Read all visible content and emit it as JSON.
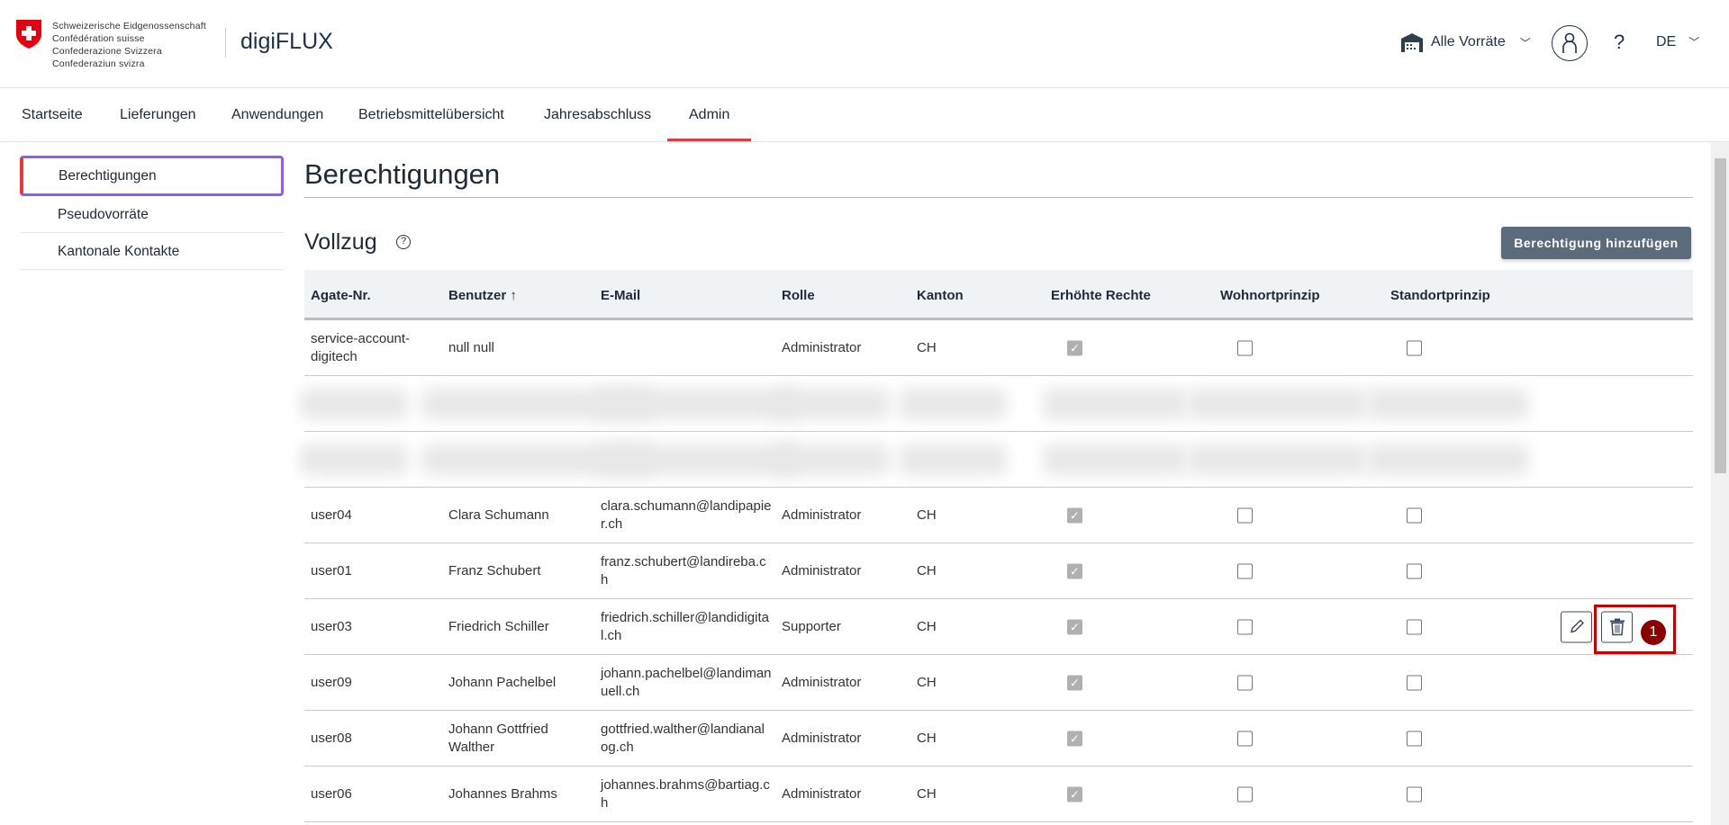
{
  "header": {
    "confederation": [
      "Schweizerische Eidgenossenschaft",
      "Confédération suisse",
      "Confederazione Svizzera",
      "Confederaziun svizra"
    ],
    "app_name": "digiFLUX",
    "stock_selector": "Alle Vorräte",
    "help": "?",
    "language": "DE"
  },
  "nav": {
    "tabs": [
      {
        "label": "Startseite"
      },
      {
        "label": "Lieferungen"
      },
      {
        "label": "Anwendungen"
      },
      {
        "label": "Betriebsmittelübersicht"
      },
      {
        "label": "Jahresabschluss"
      },
      {
        "label": "Admin",
        "active": true
      }
    ]
  },
  "sidebar": {
    "items": [
      {
        "label": "Berechtigungen",
        "active": true
      },
      {
        "label": "Pseudovorräte"
      },
      {
        "label": "Kantonale Kontakte"
      }
    ]
  },
  "main": {
    "title": "Berechtigungen",
    "section": "Vollzug",
    "add_button": "Berechtigung hinzufügen"
  },
  "table": {
    "headers": [
      "Agate-Nr.",
      "Benutzer ↑",
      "E-Mail",
      "Rolle",
      "Kanton",
      "Erhöhte Rechte",
      "Wohnortprinzip",
      "Standortprinzip"
    ],
    "rows": [
      {
        "agate": "service-account-digitech",
        "user": "null null",
        "email": "",
        "role": "Administrator",
        "canton": "CH",
        "elevated": true,
        "wohnort": false,
        "standort": false
      },
      {
        "blurred": true
      },
      {
        "blurred": true
      },
      {
        "agate": "user04",
        "user": "Clara Schumann",
        "email": "clara.schumann@landipapier.ch",
        "role": "Administrator",
        "canton": "CH",
        "elevated": true,
        "wohnort": false,
        "standort": false
      },
      {
        "agate": "user01",
        "user": "Franz Schubert",
        "email": "franz.schubert@landireba.ch",
        "role": "Administrator",
        "canton": "CH",
        "elevated": true,
        "wohnort": false,
        "standort": false
      },
      {
        "agate": "user03",
        "user": "Friedrich Schiller",
        "email": "friedrich.schiller@landidigital.ch",
        "role": "Supporter",
        "canton": "CH",
        "elevated": true,
        "wohnort": false,
        "standort": false,
        "hovered": true
      },
      {
        "agate": "user09",
        "user": "Johann Pachelbel",
        "email": "johann.pachelbel@landimanuell.ch",
        "role": "Administrator",
        "canton": "CH",
        "elevated": true,
        "wohnort": false,
        "standort": false
      },
      {
        "agate": "user08",
        "user": "Johann Gottfried Walther",
        "email": "gottfried.walther@landianalog.ch",
        "role": "Administrator",
        "canton": "CH",
        "elevated": true,
        "wohnort": false,
        "standort": false
      },
      {
        "agate": "user06",
        "user": "Johannes Brahms",
        "email": "johannes.brahms@bartiag.ch",
        "role": "Administrator",
        "canton": "CH",
        "elevated": true,
        "wohnort": false,
        "standort": false
      }
    ]
  },
  "annotation": {
    "badge": "1"
  },
  "colors": {
    "accent_red": "#e53940",
    "focus_purple": "#8b5cf6",
    "button": "#5b6b7b",
    "annotation": "#c80000"
  }
}
